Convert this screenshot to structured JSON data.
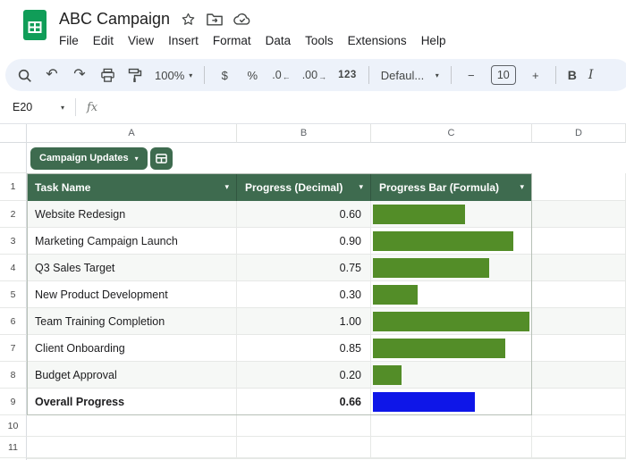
{
  "colors": {
    "logo_green": "#109d58",
    "table_header_green": "#3e6b4f",
    "bar_green": "#538d28",
    "overall_bar_blue": "#0e16e8",
    "toolbar_bg": "#edf2fa"
  },
  "icons": {
    "caret_down": "▾",
    "undo": "↶",
    "redo": "↷",
    "dec_arrow": "←",
    "inc_arrow": "→"
  },
  "titlebar": {
    "title": "ABC Campaign",
    "menus": [
      "File",
      "Edit",
      "View",
      "Insert",
      "Format",
      "Data",
      "Tools",
      "Extensions",
      "Help"
    ]
  },
  "toolbar": {
    "zoom": "100%",
    "currency": "$",
    "percent": "%",
    "decrease_decimal": ".0",
    "increase_decimal": ".00",
    "format_123": "123",
    "font_name": "Defaul...",
    "decrease_font": "−",
    "font_size": "10",
    "increase_font": "+",
    "bold": "B",
    "italic": "I"
  },
  "formula_bar": {
    "name_box": "E20",
    "fx_label": "fx"
  },
  "grid": {
    "columns": [
      "A",
      "B",
      "C",
      "D"
    ],
    "rows": [
      "1",
      "2",
      "3",
      "4",
      "5",
      "6",
      "7",
      "8",
      "9",
      "10",
      "11"
    ]
  },
  "table": {
    "name": "Campaign Updates",
    "columns": [
      "Task Name",
      "Progress (Decimal)",
      "Progress Bar (Formula)"
    ],
    "rows": [
      {
        "task": "Website Redesign",
        "value": "0.60",
        "progress": 0.6,
        "color": "#538d28",
        "bold": false
      },
      {
        "task": "Marketing Campaign Launch",
        "value": "0.90",
        "progress": 0.9,
        "color": "#538d28",
        "bold": false
      },
      {
        "task": "Q3 Sales Target",
        "value": "0.75",
        "progress": 0.75,
        "color": "#538d28",
        "bold": false
      },
      {
        "task": "New Product Development",
        "value": "0.30",
        "progress": 0.3,
        "color": "#538d28",
        "bold": false
      },
      {
        "task": "Team Training Completion",
        "value": "1.00",
        "progress": 1.0,
        "color": "#538d28",
        "bold": false
      },
      {
        "task": "Client Onboarding",
        "value": "0.85",
        "progress": 0.85,
        "color": "#538d28",
        "bold": false
      },
      {
        "task": "Budget Approval",
        "value": "0.20",
        "progress": 0.2,
        "color": "#538d28",
        "bold": false
      },
      {
        "task": "Overall Progress",
        "value": "0.66",
        "progress": 0.66,
        "color": "#0e16e8",
        "bold": true
      }
    ]
  }
}
